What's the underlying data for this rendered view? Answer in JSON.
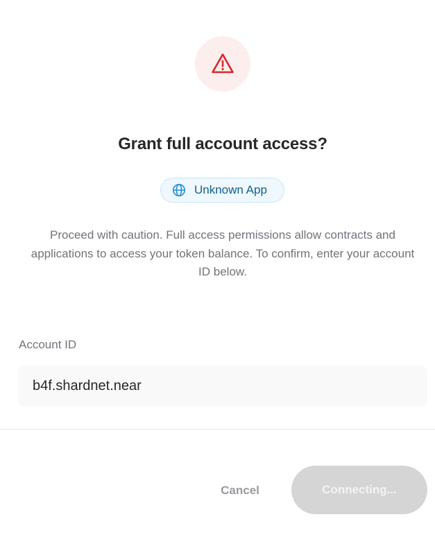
{
  "dialog": {
    "title": "Grant full account access?",
    "app_name": "Unknown App",
    "description": "Proceed with caution. Full access permissions allow contracts and applications to access your token balance. To confirm, enter your account ID below.",
    "account_field": {
      "label": "Account ID",
      "value": "b4f.shardnet.near"
    },
    "buttons": {
      "cancel_label": "Cancel",
      "connect_label": "Connecting..."
    }
  },
  "icons": {
    "header": "warning-triangle-icon",
    "app": "globe-icon"
  },
  "colors": {
    "warning": "#d9262c",
    "warning_bg": "#fdeeee",
    "app_chip_text": "#11608c",
    "app_chip_bg": "#eef8fe",
    "disabled_button_bg": "#d5d5d5"
  }
}
